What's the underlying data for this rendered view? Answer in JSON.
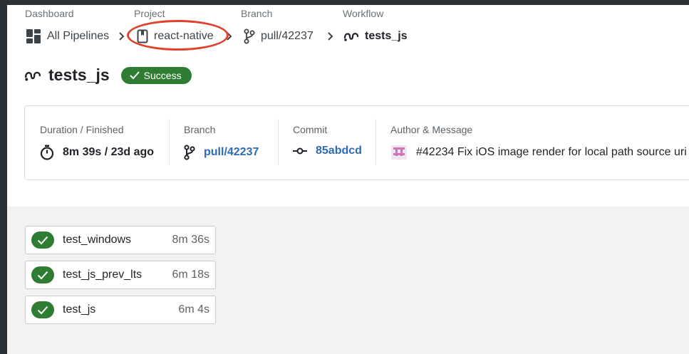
{
  "breadcrumb": {
    "labels": [
      "Dashboard",
      "Project",
      "Branch",
      "Workflow"
    ],
    "dashboard": "All Pipelines",
    "project": "react-native",
    "branch": "pull/42237",
    "workflow": "tests_js"
  },
  "header": {
    "title": "tests_js",
    "status": "Success"
  },
  "summary": {
    "duration_label": "Duration / Finished",
    "duration_value": "8m 39s / 23d ago",
    "branch_label": "Branch",
    "branch_value": "pull/42237",
    "commit_label": "Commit",
    "commit_value": "85abdcd",
    "author_label": "Author & Message",
    "message": "#42234 Fix iOS image render for local path source uri"
  },
  "jobs": [
    {
      "name": "test_windows",
      "duration": "8m 36s",
      "status": "success"
    },
    {
      "name": "test_js_prev_lts",
      "duration": "6m 18s",
      "status": "success"
    },
    {
      "name": "test_js",
      "duration": "6m 4s",
      "status": "success"
    }
  ],
  "colors": {
    "success": "#2e7d32",
    "link": "#2d6bb5",
    "annotation": "#e0412d"
  }
}
